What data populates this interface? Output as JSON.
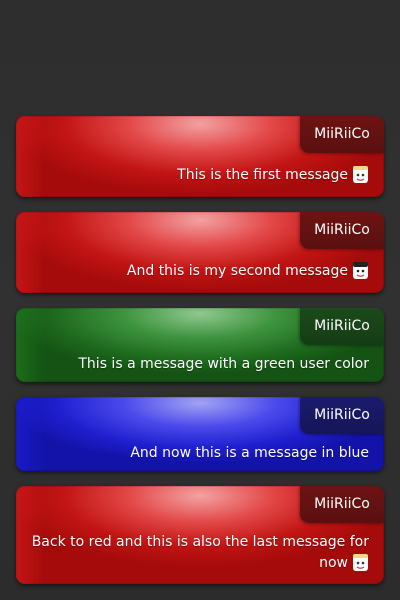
{
  "messages": [
    {
      "user": "MiiRiiCo",
      "text": "This is the first message",
      "color": "#cc1a1a",
      "emote": "cup-emote-icon"
    },
    {
      "user": "MiiRiiCo",
      "text": "And this is my second message",
      "color": "#cc1a1a",
      "emote": "cup-emote-icon"
    },
    {
      "user": "MiiRiiCo",
      "text": "This is a message with a green user color",
      "color": "#237823",
      "emote": null
    },
    {
      "user": "MiiRiiCo",
      "text": "And now this is a message in blue",
      "color": "#2222d8",
      "emote": null
    },
    {
      "user": "MiiRiiCo",
      "text_line1": "Back to red and this is also the last message for",
      "text_line2": "now",
      "color": "#cc1a1a",
      "emote": "cup-emote-icon"
    }
  ]
}
